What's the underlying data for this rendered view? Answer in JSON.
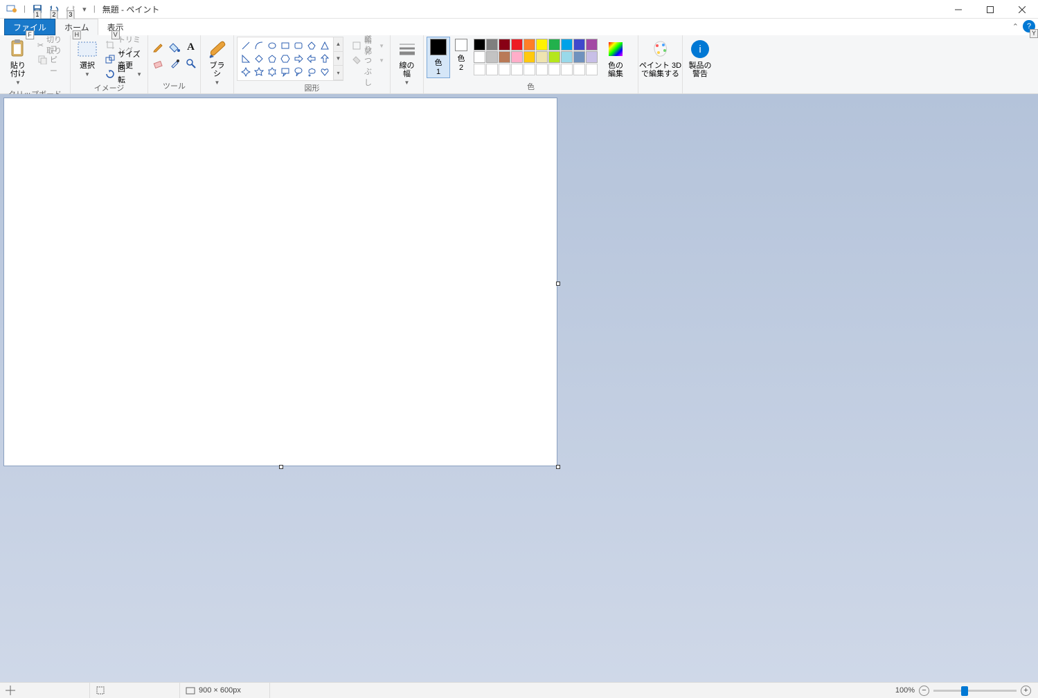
{
  "title": "無題 - ペイント",
  "qat_keytips": [
    "1",
    "2",
    "3"
  ],
  "tabs": {
    "file": "ファイル",
    "file_key": "F",
    "home": "ホーム",
    "home_key": "H",
    "view": "表示",
    "view_key": "V"
  },
  "help_key": "Y",
  "groups": {
    "clipboard": {
      "label": "クリップボード",
      "paste": "貼り付け",
      "cut": "切り取り",
      "copy": "コピー"
    },
    "image": {
      "label": "イメージ",
      "select": "選択",
      "trim": "トリミング",
      "resize": "サイズ変更",
      "rotate": "回転"
    },
    "tools": {
      "label": "ツール"
    },
    "brush": {
      "label": "ブラシ"
    },
    "shapes": {
      "label": "図形",
      "outline": "輪郭",
      "fill": "塗りつぶし"
    },
    "linewidth": {
      "label": "線の幅"
    },
    "colors": {
      "label": "色",
      "color1": "色",
      "color1_num": "1",
      "color2": "色",
      "color2_num": "2",
      "edit": "色の\n編集"
    },
    "paint3d": {
      "label": "ペイント 3D\nで編集する"
    },
    "alerts": {
      "label": "製品の\n警告"
    }
  },
  "color1_value": "#000000",
  "color2_value": "#ffffff",
  "palette_row1": [
    "#000000",
    "#7f7f7f",
    "#880015",
    "#ed1c24",
    "#ff7f27",
    "#fff200",
    "#22b14c",
    "#00a2e8",
    "#3f48cc",
    "#a349a4"
  ],
  "palette_row2": [
    "#ffffff",
    "#c3c3c3",
    "#b97a57",
    "#ffaec9",
    "#ffc90e",
    "#efe4b0",
    "#b5e61d",
    "#99d9ea",
    "#7092be",
    "#c8bfe7"
  ],
  "status": {
    "canvas_size": "900 × 600px",
    "zoom": "100%"
  }
}
